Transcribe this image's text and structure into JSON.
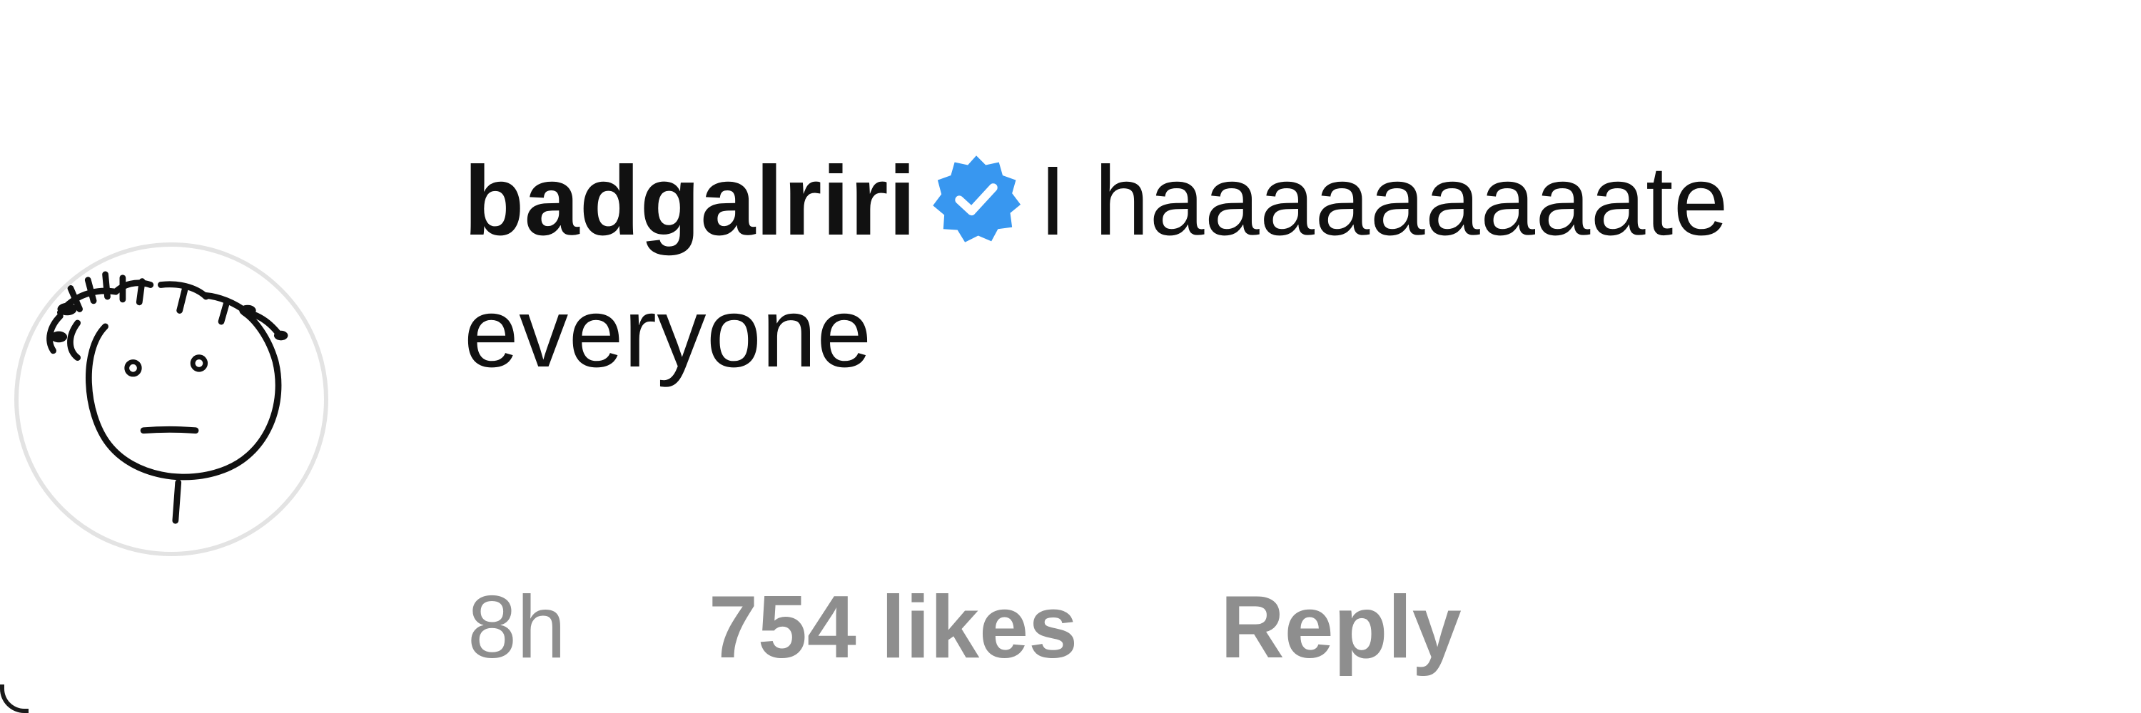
{
  "comment": {
    "username": "badgalriri",
    "verified_icon": "verified-badge-icon",
    "verified_color": "#3897f0",
    "text_line1": "I haaaaaaaaate",
    "text_line2": "everyone"
  },
  "avatar": {
    "icon": "doodle-face-avatar"
  },
  "meta": {
    "time": "8h",
    "likes": "754 likes",
    "reply": "Reply"
  }
}
